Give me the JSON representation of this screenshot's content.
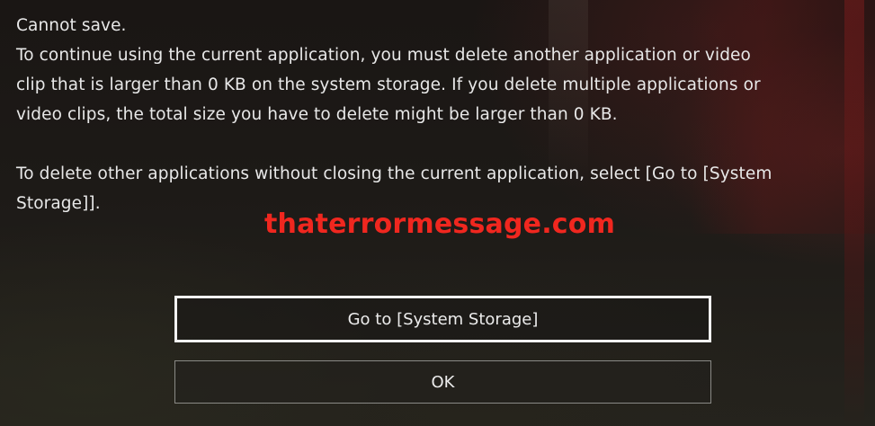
{
  "dialog": {
    "title": "Cannot save.",
    "line1": "To continue using the current application, you must delete another application or video",
    "line2": "clip that is larger than 0 KB on the system storage. If you delete multiple applications or",
    "line3": "video clips, the total size you have to delete might be larger than 0 KB.",
    "line4": "To delete other applications without closing the current application, select [Go to [System",
    "line5": "Storage]]."
  },
  "watermark": "thaterrormessage.com",
  "buttons": {
    "go_to_storage": "Go to [System Storage]",
    "ok": "OK"
  },
  "colors": {
    "watermark": "#f0271f",
    "text": "#e8e8e8",
    "focus_border": "#f2f2f2"
  }
}
